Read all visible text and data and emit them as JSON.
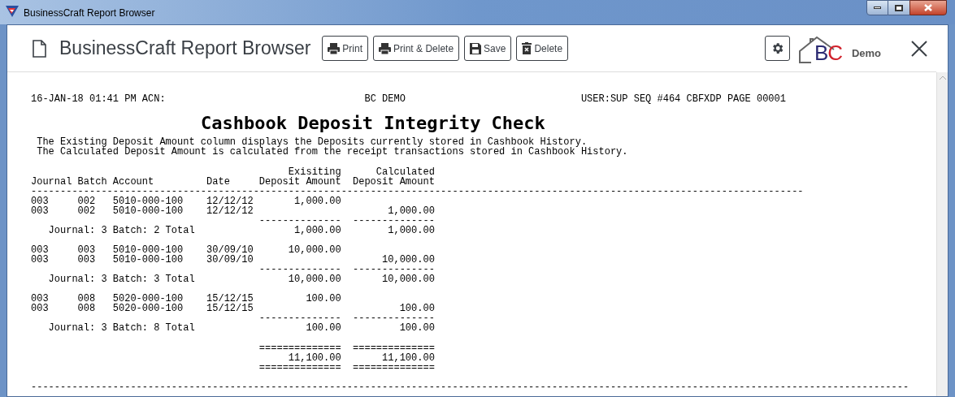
{
  "window": {
    "title": "BusinessCraft Report Browser"
  },
  "toolbar": {
    "title": "BusinessCraft Report Browser",
    "buttons": [
      {
        "label": "Print",
        "kind": "print"
      },
      {
        "label": "Print & Delete",
        "kind": "print"
      },
      {
        "label": "Save",
        "kind": "save"
      },
      {
        "label": "Delete",
        "kind": "delete"
      }
    ],
    "logo": {
      "letters": "BC",
      "tag": "Demo"
    }
  },
  "report": {
    "header_left": "16-JAN-18 01:41 PM ACN:",
    "header_center": "BC DEMO",
    "header_right": "USER:SUP SEQ #464 CBFXDP PAGE 00001",
    "title": "Cashbook Deposit Integrity Check",
    "description": [
      "The Existing Deposit Amount column displays the Deposits currently stored in Cashbook History.",
      "The Calculated Deposit Amount is calculated from the receipt transactions stored in Cashbook History."
    ],
    "columns": [
      {
        "label": "Journal"
      },
      {
        "label": "Batch"
      },
      {
        "label": "Account"
      },
      {
        "label": "Date"
      },
      {
        "label_top": "Exisiting",
        "label": "Deposit Amount"
      },
      {
        "label_top": "Calculated",
        "label": "Deposit Amount"
      }
    ],
    "header_rule": "------------------------------------------------------------------------------------------------------------------------------------",
    "groups": [
      {
        "rows": [
          {
            "journal": "003",
            "batch": "002",
            "account": "5010-000-100",
            "date": "12/12/12",
            "existing": "1,000.00"
          },
          {
            "journal": "003",
            "batch": "002",
            "account": "5010-000-100",
            "date": "12/12/12",
            "calculated": "1,000.00"
          }
        ],
        "rule": "--------------",
        "total_label": "Journal: 3 Batch: 2 Total",
        "total_existing": "1,000.00",
        "total_calculated": "1,000.00"
      },
      {
        "rows": [
          {
            "journal": "003",
            "batch": "003",
            "account": "5010-000-100",
            "date": "30/09/10",
            "existing": "10,000.00"
          },
          {
            "journal": "003",
            "batch": "003",
            "account": "5010-000-100",
            "date": "30/09/10",
            "calculated": "10,000.00"
          }
        ],
        "rule": "--------------",
        "total_label": "Journal: 3 Batch: 3 Total",
        "total_existing": "10,000.00",
        "total_calculated": "10,000.00"
      },
      {
        "rows": [
          {
            "journal": "003",
            "batch": "008",
            "account": "5020-000-100",
            "date": "15/12/15",
            "existing": "100.00"
          },
          {
            "journal": "003",
            "batch": "008",
            "account": "5020-000-100",
            "date": "15/12/15",
            "calculated": "100.00"
          }
        ],
        "rule": "--------------",
        "total_label": "Journal: 3 Batch: 8 Total",
        "total_existing": "100.00",
        "total_calculated": "100.00"
      }
    ],
    "grand_total": {
      "rule": "==============",
      "existing": "11,100.00",
      "calculated": "11,100.00"
    },
    "footer_rule": "------------------------------------------------------------------------------------------------------------------------------------------------------"
  }
}
